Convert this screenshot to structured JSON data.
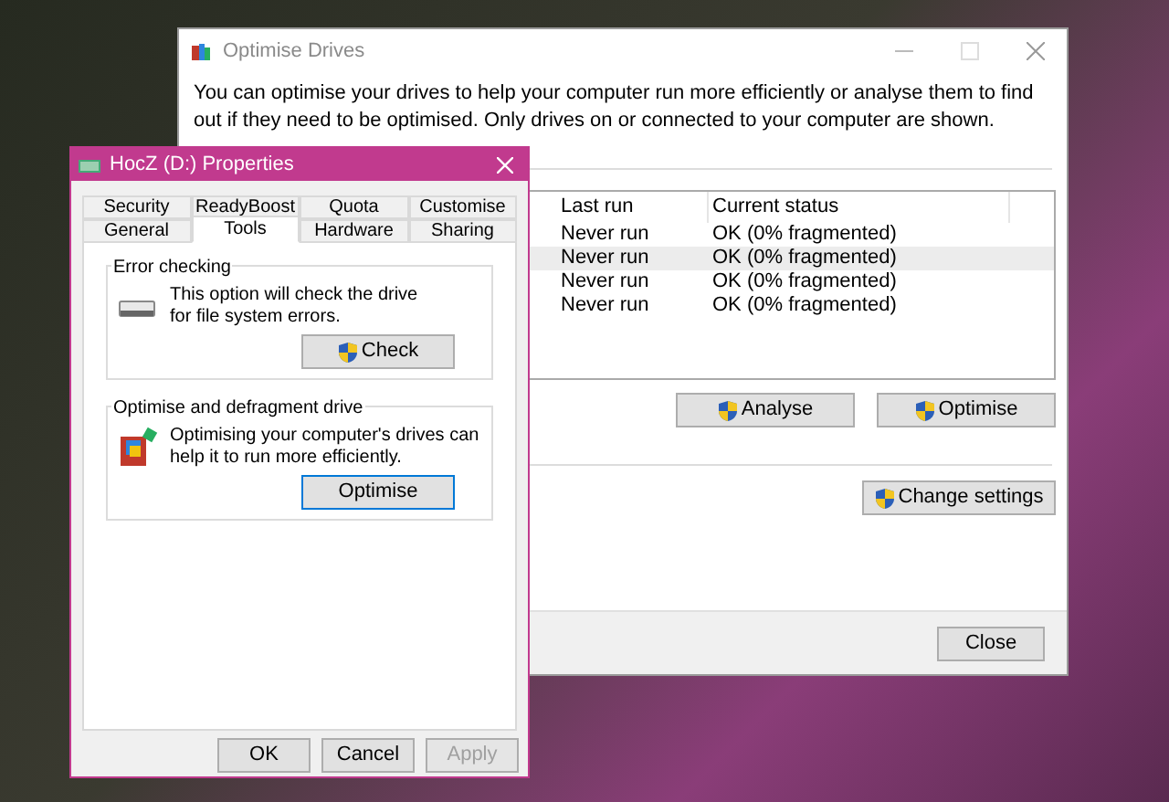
{
  "optimise_window": {
    "title": "Optimise Drives",
    "intro": "You can optimise your drives to help your computer run more efficiently or analyse them to find out if they need to be optimised. Only drives on or connected to your computer are shown.",
    "table": {
      "columns": [
        "Last run",
        "Current status"
      ],
      "rows": [
        {
          "last_run": "Never run",
          "current_status": "OK (0% fragmented)",
          "selected": false
        },
        {
          "last_run": "Never run",
          "current_status": "OK (0% fragmented)",
          "selected": true
        },
        {
          "last_run": "Never run",
          "current_status": "OK (0% fragmented)",
          "selected": false
        },
        {
          "last_run": "Never run",
          "current_status": "OK (0% fragmented)",
          "selected": false
        }
      ]
    },
    "actions": [
      "Analyse",
      "Optimise"
    ],
    "schedule_button": "Change settings",
    "close_button": "Close"
  },
  "properties_dialog": {
    "title": "HocZ (D:) Properties",
    "tab_rows": [
      [
        {
          "label": "Security",
          "selected": false
        },
        {
          "label": "ReadyBoost",
          "selected": false
        },
        {
          "label": "Quota",
          "selected": false
        },
        {
          "label": "Customise",
          "selected": false
        }
      ],
      [
        {
          "label": "General",
          "selected": false
        },
        {
          "label": "Tools",
          "selected": true
        },
        {
          "label": "Hardware",
          "selected": false
        },
        {
          "label": "Sharing",
          "selected": false
        }
      ]
    ],
    "groups": [
      {
        "kind": "check",
        "title": "Error checking",
        "text": "This option will check the drive for file system errors.",
        "button": "Check",
        "shield": true
      },
      {
        "kind": "defrag",
        "title": "Optimise and defragment drive",
        "text": "Optimising your computer's drives can help it to run more efficiently.",
        "button": "Optimise",
        "shield": false
      }
    ],
    "buttons": [
      {
        "label": "OK",
        "disabled": false
      },
      {
        "label": "Cancel",
        "disabled": false
      },
      {
        "label": "Apply",
        "disabled": true
      }
    ]
  }
}
